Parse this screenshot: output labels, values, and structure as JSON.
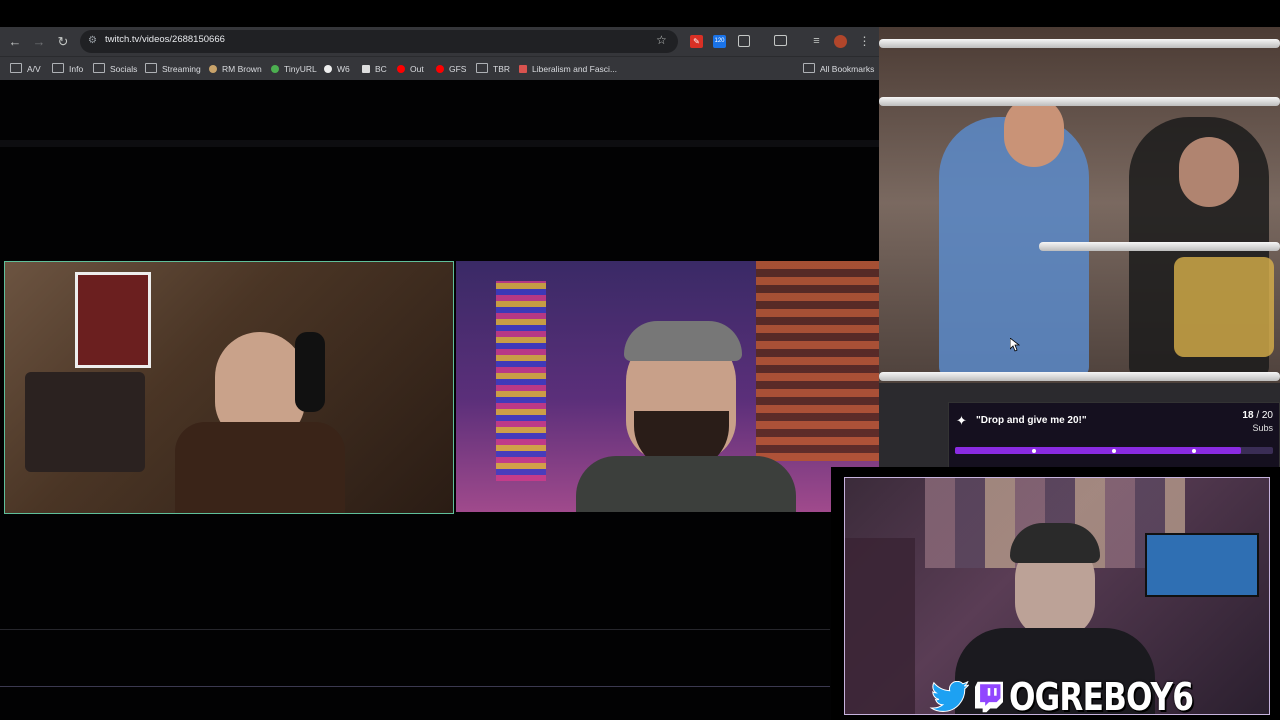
{
  "browser": {
    "url": "twitch.tv/videos/2688150666",
    "nav": {
      "back": "←",
      "forward": "→",
      "reload": "↻"
    },
    "extensions": [
      {
        "name": "pinned-ext",
        "label": "",
        "color": "#d93025"
      },
      {
        "name": "counter-ext",
        "label": "120",
        "color": "#1a73e8"
      },
      {
        "name": "puzzle-ext",
        "label": "",
        "color": "#5f6368"
      }
    ],
    "bookmarks": [
      {
        "label": "A/V",
        "kind": "folder"
      },
      {
        "label": "Info",
        "kind": "folder"
      },
      {
        "label": "Socials",
        "kind": "folder"
      },
      {
        "label": "Streaming",
        "kind": "folder"
      },
      {
        "label": "RM Brown",
        "kind": "site"
      },
      {
        "label": "TinyURL",
        "kind": "site"
      },
      {
        "label": "W6",
        "kind": "site"
      },
      {
        "label": "BC",
        "kind": "site"
      },
      {
        "label": "Out",
        "kind": "youtube"
      },
      {
        "label": "GFS",
        "kind": "youtube"
      },
      {
        "label": "TBR",
        "kind": "folder"
      },
      {
        "label": "Liberalism and Fasci...",
        "kind": "site"
      }
    ],
    "all_bookmarks": "All Bookmarks"
  },
  "sub_goal": {
    "title": "\"Drop and give me 20!\"",
    "current": "18",
    "separator": "/",
    "target": "20",
    "unit": "Subs",
    "progress": 0.9
  },
  "overlay": {
    "handle": "OGREBOY6",
    "icons": [
      "twitter-icon",
      "twitch-icon"
    ]
  },
  "colors": {
    "accent": "#8a2be2",
    "chrome_bg": "#35363a",
    "omnibox_bg": "#202124"
  }
}
